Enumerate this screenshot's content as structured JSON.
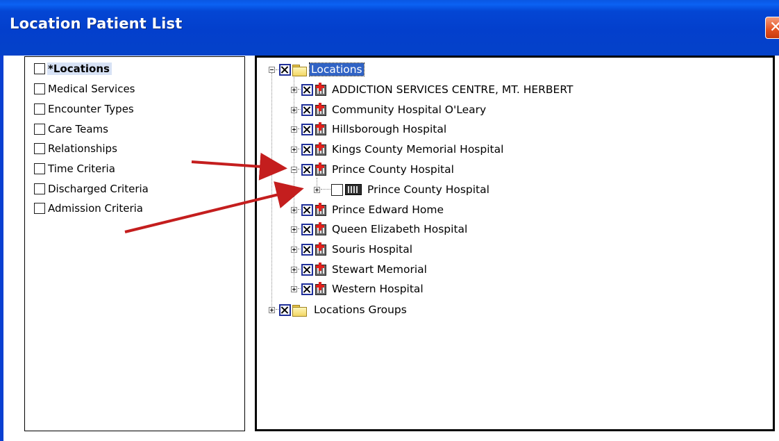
{
  "window": {
    "title": "Location Patient List",
    "close_glyph": "✕",
    "close_icon": "close-icon"
  },
  "criteria": [
    {
      "label": "*Locations",
      "checked": false,
      "selected": true
    },
    {
      "label": "Medical Services",
      "checked": false
    },
    {
      "label": "Encounter Types",
      "checked": false
    },
    {
      "label": "Care Teams",
      "checked": false
    },
    {
      "label": "Relationships",
      "checked": false
    },
    {
      "label": "Time Criteria",
      "checked": false
    },
    {
      "label": "Discharged Criteria",
      "checked": false
    },
    {
      "label": "Admission Criteria",
      "checked": false
    }
  ],
  "tree": {
    "root": {
      "label": "Locations",
      "expanded": true,
      "checked": true,
      "icon": "folder-icon",
      "selected": true
    },
    "children": [
      {
        "label": "ADDICTION SERVICES CENTRE, MT. HERBERT",
        "expanded": false,
        "checked": true,
        "icon": "hospital-icon"
      },
      {
        "label": "Community Hospital O'Leary",
        "expanded": false,
        "checked": true,
        "icon": "hospital-icon"
      },
      {
        "label": "Hillsborough Hospital",
        "expanded": false,
        "checked": true,
        "icon": "hospital-icon"
      },
      {
        "label": "Kings County Memorial Hospital",
        "expanded": false,
        "checked": true,
        "icon": "hospital-icon"
      },
      {
        "label": "Prince County Hospital",
        "expanded": true,
        "checked": true,
        "icon": "hospital-icon"
      },
      {
        "label": "Prince County Hospital",
        "expanded": false,
        "checked": false,
        "icon": "unit-icon",
        "child_of": "Prince County Hospital"
      },
      {
        "label": "Prince Edward Home",
        "expanded": false,
        "checked": true,
        "icon": "hospital-icon"
      },
      {
        "label": "Queen Elizabeth Hospital",
        "expanded": false,
        "checked": true,
        "icon": "hospital-icon"
      },
      {
        "label": "Souris Hospital",
        "expanded": false,
        "checked": true,
        "icon": "hospital-icon"
      },
      {
        "label": "Stewart Memorial",
        "expanded": false,
        "checked": true,
        "icon": "hospital-icon"
      },
      {
        "label": "Western Hospital",
        "expanded": false,
        "checked": true,
        "icon": "hospital-icon"
      }
    ],
    "groups": {
      "label": "Locations Groups",
      "expanded": false,
      "checked": true,
      "icon": "folder-icon"
    }
  },
  "colors": {
    "titlebar": "#0446d4",
    "selection": "#3163c5",
    "annotation_arrow": "#c41e1e"
  }
}
